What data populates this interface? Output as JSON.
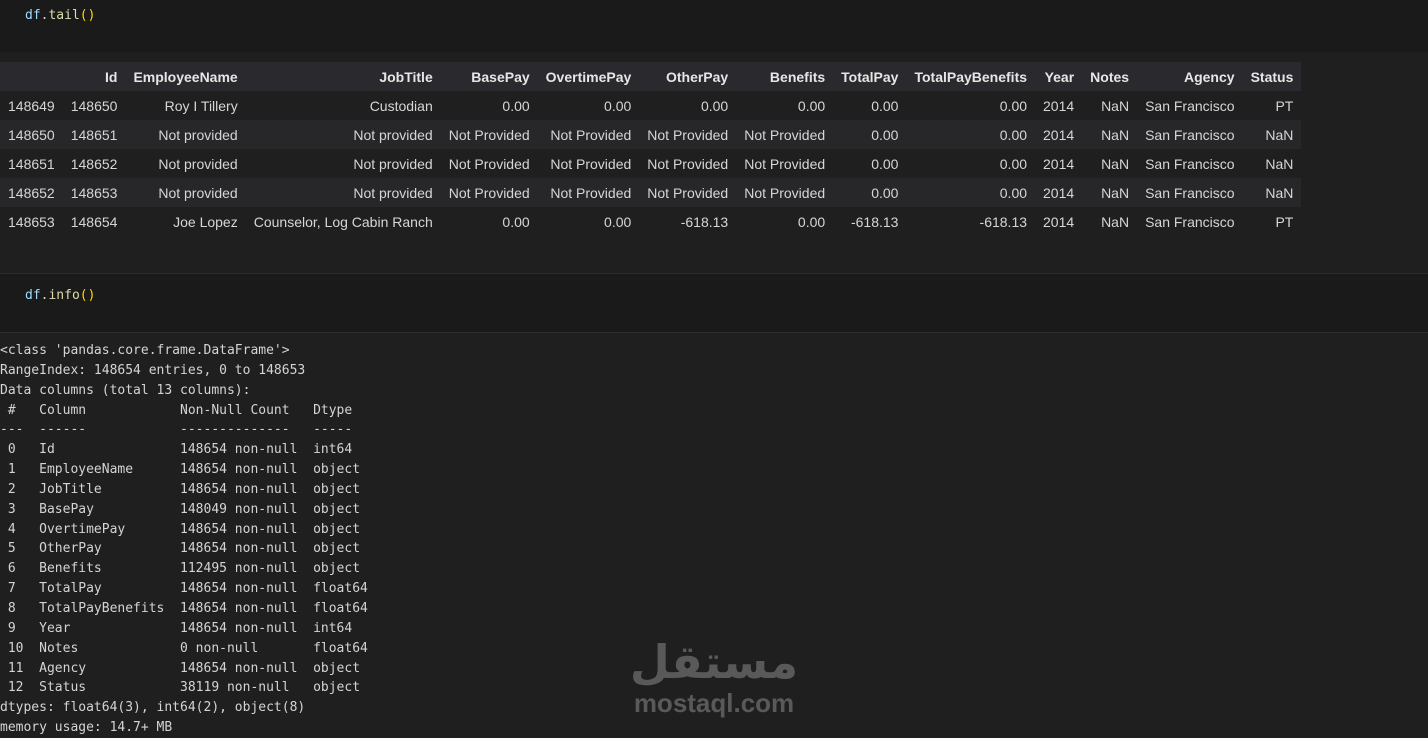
{
  "cell1": {
    "code_obj": "df",
    "code_dot": ".",
    "code_fn": "tail",
    "code_parens": "()"
  },
  "tail_table": {
    "columns": [
      "",
      "Id",
      "EmployeeName",
      "JobTitle",
      "BasePay",
      "OvertimePay",
      "OtherPay",
      "Benefits",
      "TotalPay",
      "TotalPayBenefits",
      "Year",
      "Notes",
      "Agency",
      "Status"
    ],
    "rows": [
      [
        "148649",
        "148650",
        "Roy I Tillery",
        "Custodian",
        "0.00",
        "0.00",
        "0.00",
        "0.00",
        "0.00",
        "0.00",
        "2014",
        "NaN",
        "San Francisco",
        "PT"
      ],
      [
        "148650",
        "148651",
        "Not provided",
        "Not provided",
        "Not Provided",
        "Not Provided",
        "Not Provided",
        "Not Provided",
        "0.00",
        "0.00",
        "2014",
        "NaN",
        "San Francisco",
        "NaN"
      ],
      [
        "148651",
        "148652",
        "Not provided",
        "Not provided",
        "Not Provided",
        "Not Provided",
        "Not Provided",
        "Not Provided",
        "0.00",
        "0.00",
        "2014",
        "NaN",
        "San Francisco",
        "NaN"
      ],
      [
        "148652",
        "148653",
        "Not provided",
        "Not provided",
        "Not Provided",
        "Not Provided",
        "Not Provided",
        "Not Provided",
        "0.00",
        "0.00",
        "2014",
        "NaN",
        "San Francisco",
        "NaN"
      ],
      [
        "148653",
        "148654",
        "Joe Lopez",
        "Counselor, Log Cabin Ranch",
        "0.00",
        "0.00",
        "-618.13",
        "0.00",
        "-618.13",
        "-618.13",
        "2014",
        "NaN",
        "San Francisco",
        "PT"
      ]
    ]
  },
  "cell2": {
    "code_obj": "df",
    "code_dot": ".",
    "code_fn": "info",
    "code_parens": "()"
  },
  "info_output": {
    "lines": [
      "<class 'pandas.core.frame.DataFrame'>",
      "RangeIndex: 148654 entries, 0 to 148653",
      "Data columns (total 13 columns):",
      " #   Column            Non-Null Count   Dtype  ",
      "---  ------            --------------   -----  ",
      " 0   Id                148654 non-null  int64  ",
      " 1   EmployeeName      148654 non-null  object ",
      " 2   JobTitle          148654 non-null  object ",
      " 3   BasePay           148049 non-null  object ",
      " 4   OvertimePay       148654 non-null  object ",
      " 5   OtherPay          148654 non-null  object ",
      " 6   Benefits          112495 non-null  object ",
      " 7   TotalPay          148654 non-null  float64",
      " 8   TotalPayBenefits  148654 non-null  float64",
      " 9   Year              148654 non-null  int64  ",
      " 10  Notes             0 non-null       float64",
      " 11  Agency            148654 non-null  object ",
      " 12  Status            38119 non-null   object ",
      "dtypes: float64(3), int64(2), object(8)",
      "memory usage: 14.7+ MB"
    ]
  },
  "watermark": {
    "arabic": "مستقل",
    "latin": "mostaql.com"
  }
}
